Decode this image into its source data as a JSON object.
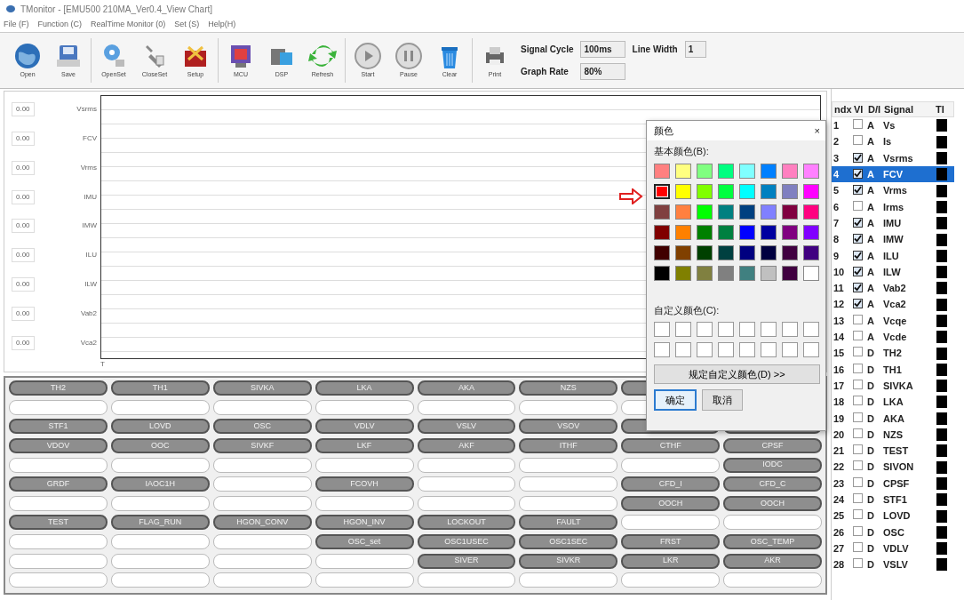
{
  "window": {
    "title": "TMonitor - [EMU500 210MA_Ver0.4_View Chart]"
  },
  "menu": [
    "File (F)",
    "Function (C)",
    "RealTime Monitor (0)",
    "Set (S)",
    "Help(H)"
  ],
  "toolbar": [
    {
      "kind": "globe",
      "label": "Open"
    },
    {
      "kind": "disk",
      "label": "Save"
    },
    {
      "kind": "separator"
    },
    {
      "kind": "gear",
      "label": "OpenSet"
    },
    {
      "kind": "tools",
      "label": "CloseSet"
    },
    {
      "kind": "box",
      "label": "Setup"
    },
    {
      "kind": "separator"
    },
    {
      "kind": "chart",
      "label": "MCU"
    },
    {
      "kind": "folder",
      "label": "DSP"
    },
    {
      "kind": "refresh",
      "label": "Refresh"
    },
    {
      "kind": "separator"
    },
    {
      "kind": "play",
      "label": "Start"
    },
    {
      "kind": "pause",
      "label": "Pause"
    },
    {
      "kind": "trash",
      "label": "Clear"
    },
    {
      "kind": "separator"
    },
    {
      "kind": "printer",
      "label": "Print"
    }
  ],
  "settings": [
    {
      "label": "Signal Cycle",
      "value": "100ms"
    },
    {
      "label": "Line Width",
      "value": "1"
    },
    {
      "label": "Graph Rate",
      "value": "80%"
    }
  ],
  "chart": {
    "x_label": "T",
    "channels": [
      {
        "name": "Vsrms",
        "value": "0.00"
      },
      {
        "name": "FCV",
        "value": "0.00"
      },
      {
        "name": "Vrms",
        "value": "0.00"
      },
      {
        "name": "IMU",
        "value": "0.00"
      },
      {
        "name": "IMW",
        "value": "0.00"
      },
      {
        "name": "ILU",
        "value": "0.00"
      },
      {
        "name": "ILW",
        "value": "0.00"
      },
      {
        "name": "Vab2",
        "value": "0.00"
      },
      {
        "name": "Vca2",
        "value": "0.00"
      }
    ]
  },
  "flag_grid": [
    [
      {
        "kind": "button",
        "label": "TH2"
      },
      {
        "kind": "button",
        "label": "TH1"
      },
      {
        "kind": "button",
        "label": "SIVKA"
      },
      {
        "kind": "button",
        "label": "LKA"
      },
      {
        "kind": "button",
        "label": "AKA"
      },
      {
        "kind": "button",
        "label": "NZS"
      },
      {
        "kind": "button"
      },
      {
        "kind": "hidden"
      }
    ],
    [
      {
        "kind": "blank"
      },
      {
        "kind": "blank"
      },
      {
        "kind": "blank"
      },
      {
        "kind": "blank"
      },
      {
        "kind": "blank"
      },
      {
        "kind": "blank"
      },
      {
        "kind": "blank"
      },
      {
        "kind": "hidden"
      }
    ],
    [
      {
        "kind": "button",
        "label": "STF1"
      },
      {
        "kind": "button",
        "label": "LOVD"
      },
      {
        "kind": "button",
        "label": "OSC"
      },
      {
        "kind": "button",
        "label": "VDLV"
      },
      {
        "kind": "button",
        "label": "VSLV"
      },
      {
        "kind": "button",
        "label": "VSOV"
      },
      {
        "kind": "button"
      },
      {
        "kind": "button"
      }
    ],
    [
      {
        "kind": "button",
        "label": "VDOV"
      },
      {
        "kind": "button",
        "label": "OOC"
      },
      {
        "kind": "button",
        "label": "SIVKF"
      },
      {
        "kind": "button",
        "label": "LKF"
      },
      {
        "kind": "button",
        "label": "AKF"
      },
      {
        "kind": "button",
        "label": "ITHF"
      },
      {
        "kind": "button",
        "label": "CTHF"
      },
      {
        "kind": "button",
        "label": "CPSF"
      }
    ],
    [
      {
        "kind": "blank"
      },
      {
        "kind": "blank"
      },
      {
        "kind": "blank"
      },
      {
        "kind": "blank"
      },
      {
        "kind": "blank"
      },
      {
        "kind": "blank"
      },
      {
        "kind": "blank"
      },
      {
        "kind": "button",
        "label": "IODC"
      }
    ],
    [
      {
        "kind": "button",
        "label": "GRDF"
      },
      {
        "kind": "button",
        "label": "IAOC1H"
      },
      {
        "kind": "blank"
      },
      {
        "kind": "button",
        "label": "FCOVH"
      },
      {
        "kind": "blank"
      },
      {
        "kind": "blank"
      },
      {
        "kind": "button",
        "label": "CFD_I"
      },
      {
        "kind": "button",
        "label": "CFD_C"
      }
    ],
    [
      {
        "kind": "blank"
      },
      {
        "kind": "blank"
      },
      {
        "kind": "blank"
      },
      {
        "kind": "blank"
      },
      {
        "kind": "blank"
      },
      {
        "kind": "blank"
      },
      {
        "kind": "button",
        "label": "OOCH"
      },
      {
        "kind": "button",
        "label": "OOCH"
      }
    ],
    [
      {
        "kind": "button",
        "label": "TEST"
      },
      {
        "kind": "button",
        "label": "FLAG_RUN"
      },
      {
        "kind": "button",
        "label": "HGON_CONV"
      },
      {
        "kind": "button",
        "label": "HGON_INV"
      },
      {
        "kind": "button",
        "label": "LOCKOUT"
      },
      {
        "kind": "button",
        "label": "FAULT"
      },
      {
        "kind": "blank"
      },
      {
        "kind": "blank"
      }
    ],
    [
      {
        "kind": "blank"
      },
      {
        "kind": "blank"
      },
      {
        "kind": "blank"
      },
      {
        "kind": "button",
        "label": "OSC_set"
      },
      {
        "kind": "button",
        "label": "OSC1USEC"
      },
      {
        "kind": "button",
        "label": "OSC1SEC"
      },
      {
        "kind": "button",
        "label": "FRST"
      },
      {
        "kind": "button",
        "label": "OSC_TEMP"
      }
    ],
    [
      {
        "kind": "blank"
      },
      {
        "kind": "blank"
      },
      {
        "kind": "blank"
      },
      {
        "kind": "blank"
      },
      {
        "kind": "button",
        "label": "SIVER"
      },
      {
        "kind": "button",
        "label": "SIVKR"
      },
      {
        "kind": "button",
        "label": "LKR"
      },
      {
        "kind": "button",
        "label": "AKR"
      }
    ],
    [
      {
        "kind": "blank"
      },
      {
        "kind": "blank"
      },
      {
        "kind": "blank"
      },
      {
        "kind": "blank"
      },
      {
        "kind": "blank"
      },
      {
        "kind": "blank"
      },
      {
        "kind": "blank"
      },
      {
        "kind": "blank"
      }
    ]
  ],
  "color_dialog": {
    "title": "颜色",
    "close": "×",
    "basic_label": "基本颜色(B):",
    "custom_label": "自定义颜色(C):",
    "define_button": "规定自定义颜色(D) >>",
    "ok": "确定",
    "cancel": "取消",
    "swatches": [
      {
        "color": "#ff8080",
        "selected": false
      },
      {
        "color": "#ffff80",
        "selected": false
      },
      {
        "color": "#80ff80",
        "selected": false
      },
      {
        "color": "#00ff80",
        "selected": false
      },
      {
        "color": "#80ffff",
        "selected": false
      },
      {
        "color": "#0080ff",
        "selected": false
      },
      {
        "color": "#ff80c0",
        "selected": false
      },
      {
        "color": "#ff80ff",
        "selected": false
      },
      {
        "color": "#ff0000",
        "selected": true
      },
      {
        "color": "#ffff00",
        "selected": false
      },
      {
        "color": "#80ff00",
        "selected": false
      },
      {
        "color": "#00ff40",
        "selected": false
      },
      {
        "color": "#00ffff",
        "selected": false
      },
      {
        "color": "#0080c0",
        "selected": false
      },
      {
        "color": "#8080c0",
        "selected": false
      },
      {
        "color": "#ff00ff",
        "selected": false
      },
      {
        "color": "#804040",
        "selected": false
      },
      {
        "color": "#ff8040",
        "selected": false
      },
      {
        "color": "#00ff00",
        "selected": false
      },
      {
        "color": "#008080",
        "selected": false
      },
      {
        "color": "#004080",
        "selected": false
      },
      {
        "color": "#8080ff",
        "selected": false
      },
      {
        "color": "#800040",
        "selected": false
      },
      {
        "color": "#ff0080",
        "selected": false
      },
      {
        "color": "#800000",
        "selected": false
      },
      {
        "color": "#ff8000",
        "selected": false
      },
      {
        "color": "#008000",
        "selected": false
      },
      {
        "color": "#008040",
        "selected": false
      },
      {
        "color": "#0000ff",
        "selected": false
      },
      {
        "color": "#0000a0",
        "selected": false
      },
      {
        "color": "#800080",
        "selected": false
      },
      {
        "color": "#8000ff",
        "selected": false
      },
      {
        "color": "#400000",
        "selected": false
      },
      {
        "color": "#804000",
        "selected": false
      },
      {
        "color": "#004000",
        "selected": false
      },
      {
        "color": "#004040",
        "selected": false
      },
      {
        "color": "#000080",
        "selected": false
      },
      {
        "color": "#000040",
        "selected": false
      },
      {
        "color": "#400040",
        "selected": false
      },
      {
        "color": "#400080",
        "selected": false
      },
      {
        "color": "#000000",
        "selected": false
      },
      {
        "color": "#808000",
        "selected": false
      },
      {
        "color": "#808040",
        "selected": false
      },
      {
        "color": "#808080",
        "selected": false
      },
      {
        "color": "#408080",
        "selected": false
      },
      {
        "color": "#c0c0c0",
        "selected": false
      },
      {
        "color": "#400040",
        "selected": false
      },
      {
        "color": "#ffffff",
        "selected": false
      }
    ]
  },
  "signal_table": {
    "columns": [
      "ndx",
      "VI",
      "D/I",
      "Signal",
      "TI"
    ],
    "rows": [
      {
        "ndx": "1",
        "checked": false,
        "type": "A",
        "signal": "Vs",
        "color": "#000000",
        "selected": false
      },
      {
        "ndx": "2",
        "checked": false,
        "type": "A",
        "signal": "Is",
        "color": "#000000",
        "selected": false
      },
      {
        "ndx": "3",
        "checked": true,
        "type": "A",
        "signal": "Vsrms",
        "color": "#000000",
        "selected": false
      },
      {
        "ndx": "4",
        "checked": true,
        "type": "A",
        "signal": "FCV",
        "color": "#000000",
        "selected": true
      },
      {
        "ndx": "5",
        "checked": true,
        "type": "A",
        "signal": "Vrms",
        "color": "#000000",
        "selected": false
      },
      {
        "ndx": "6",
        "checked": false,
        "type": "A",
        "signal": "Irms",
        "color": "#000000",
        "selected": false
      },
      {
        "ndx": "7",
        "checked": true,
        "type": "A",
        "signal": "IMU",
        "color": "#000000",
        "selected": false
      },
      {
        "ndx": "8",
        "checked": true,
        "type": "A",
        "signal": "IMW",
        "color": "#000000",
        "selected": false
      },
      {
        "ndx": "9",
        "checked": true,
        "type": "A",
        "signal": "ILU",
        "color": "#000000",
        "selected": false
      },
      {
        "ndx": "10",
        "checked": true,
        "type": "A",
        "signal": "ILW",
        "color": "#000000",
        "selected": false
      },
      {
        "ndx": "11",
        "checked": true,
        "type": "A",
        "signal": "Vab2",
        "color": "#000000",
        "selected": false
      },
      {
        "ndx": "12",
        "checked": true,
        "type": "A",
        "signal": "Vca2",
        "color": "#000000",
        "selected": false
      },
      {
        "ndx": "13",
        "checked": false,
        "type": "A",
        "signal": "Vcqe",
        "color": "#000000",
        "selected": false
      },
      {
        "ndx": "14",
        "checked": false,
        "type": "A",
        "signal": "Vcde",
        "color": "#000000",
        "selected": false
      },
      {
        "ndx": "15",
        "checked": false,
        "type": "D",
        "signal": "TH2",
        "color": "#000000",
        "selected": false
      },
      {
        "ndx": "16",
        "checked": false,
        "type": "D",
        "signal": "TH1",
        "color": "#000000",
        "selected": false
      },
      {
        "ndx": "17",
        "checked": false,
        "type": "D",
        "signal": "SIVKA",
        "color": "#000000",
        "selected": false
      },
      {
        "ndx": "18",
        "checked": false,
        "type": "D",
        "signal": "LKA",
        "color": "#000000",
        "selected": false
      },
      {
        "ndx": "19",
        "checked": false,
        "type": "D",
        "signal": "AKA",
        "color": "#000000",
        "selected": false
      },
      {
        "ndx": "20",
        "checked": false,
        "type": "D",
        "signal": "NZS",
        "color": "#000000",
        "selected": false
      },
      {
        "ndx": "21",
        "checked": false,
        "type": "D",
        "signal": "TEST",
        "color": "#000000",
        "selected": false
      },
      {
        "ndx": "22",
        "checked": false,
        "type": "D",
        "signal": "SIVON",
        "color": "#000000",
        "selected": false
      },
      {
        "ndx": "23",
        "checked": false,
        "type": "D",
        "signal": "CPSF",
        "color": "#000000",
        "selected": false
      },
      {
        "ndx": "24",
        "checked": false,
        "type": "D",
        "signal": "STF1",
        "color": "#000000",
        "selected": false
      },
      {
        "ndx": "25",
        "checked": false,
        "type": "D",
        "signal": "LOVD",
        "color": "#000000",
        "selected": false
      },
      {
        "ndx": "26",
        "checked": false,
        "type": "D",
        "signal": "OSC",
        "color": "#000000",
        "selected": false
      },
      {
        "ndx": "27",
        "checked": false,
        "type": "D",
        "signal": "VDLV",
        "color": "#000000",
        "selected": false
      },
      {
        "ndx": "28",
        "checked": false,
        "type": "D",
        "signal": "VSLV",
        "color": "#000000",
        "selected": false
      }
    ]
  }
}
